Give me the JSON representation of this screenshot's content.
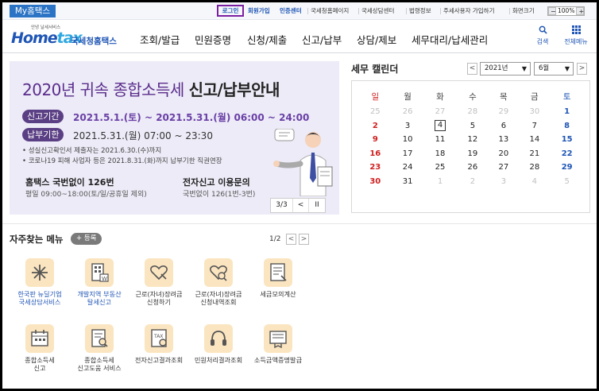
{
  "topbar": {
    "my_tab": "My홈택스",
    "login": "로그인",
    "signup": "회원가입",
    "cert": "인증센터",
    "links": [
      "국세청홈페이지",
      "국세상담센터",
      "법령정보",
      "주세사용자 가입하기",
      "화면크기"
    ],
    "zoom": {
      "minus": "−",
      "value": "100%",
      "plus": "+"
    }
  },
  "header": {
    "logo_sub": "안녕 날세서비스",
    "logo_main_a": "Home",
    "logo_main_b": "tax",
    "logo_kr": "국세청홈택스",
    "nav": [
      "조회/발급",
      "민원증명",
      "신청/제출",
      "신고/납부",
      "상담/제보",
      "세무대리/납세관리"
    ],
    "search_icon": "search-icon",
    "search_label": "검색",
    "menu_icon": "grid-menu-icon",
    "menu_label": "전체메뉴"
  },
  "banner": {
    "title_a": "2020년 귀속 종합소득세 ",
    "title_b": "신고/납부안내",
    "period1_label": "신고기간",
    "period1_value": "2021.5.1.(토) ~ 2021.5.31.(월) 06:00 ~ 24:00",
    "period2_label": "납부기한",
    "period2_value": "2021.5.31.(월) 07:00 ~ 23:30",
    "note1": "• 성실신고확인서 제출자는 2021.6.30.(수)까지",
    "note2": "• 코로나19 피해 사업자 등은 2021.8.31.(화)까지 납부기한 직권연장",
    "contact1_title": "홈택스 국번없이 126번",
    "contact1_sub": "평일 09:00~18:00(토/일/공휴일 제외)",
    "contact2_title": "전자신고 이용문의",
    "contact2_sub": "국번없이 126(1번-3번)",
    "pager": "3/3",
    "prev": "<",
    "pause": "II"
  },
  "calendar": {
    "title": "세무 캘린더",
    "prev": "<",
    "next": ">",
    "year": "2021년",
    "month": "6월",
    "weekdays": [
      "일",
      "월",
      "화",
      "수",
      "목",
      "금",
      "토"
    ],
    "weeks": [
      [
        {
          "d": "25",
          "dim": true
        },
        {
          "d": "26",
          "dim": true
        },
        {
          "d": "27",
          "dim": true
        },
        {
          "d": "28",
          "dim": true
        },
        {
          "d": "29",
          "dim": true
        },
        {
          "d": "30",
          "dim": true
        },
        {
          "d": "1"
        }
      ],
      [
        {
          "d": "2"
        },
        {
          "d": "3"
        },
        {
          "d": "4",
          "today": true
        },
        {
          "d": "5"
        },
        {
          "d": "6"
        },
        {
          "d": "7"
        },
        {
          "d": "8"
        }
      ],
      [
        {
          "d": "9"
        },
        {
          "d": "10"
        },
        {
          "d": "11"
        },
        {
          "d": "12"
        },
        {
          "d": "13"
        },
        {
          "d": "14"
        },
        {
          "d": "15"
        }
      ],
      [
        {
          "d": "16"
        },
        {
          "d": "17"
        },
        {
          "d": "18"
        },
        {
          "d": "19"
        },
        {
          "d": "20"
        },
        {
          "d": "21"
        },
        {
          "d": "22"
        }
      ],
      [
        {
          "d": "23"
        },
        {
          "d": "24"
        },
        {
          "d": "25"
        },
        {
          "d": "26"
        },
        {
          "d": "27"
        },
        {
          "d": "28"
        },
        {
          "d": "29"
        }
      ],
      [
        {
          "d": "30"
        },
        {
          "d": "31"
        },
        {
          "d": "1",
          "dim": true
        },
        {
          "d": "2",
          "dim": true
        },
        {
          "d": "3",
          "dim": true
        },
        {
          "d": "4",
          "dim": true
        },
        {
          "d": "5",
          "dim": true
        }
      ]
    ]
  },
  "favorites": {
    "title": "자주찾는 메뉴",
    "add": "+ 등록",
    "page": "1/2",
    "prev": "<",
    "next": ">",
    "items": [
      {
        "label": "한국판 뉴딜기업\n국세상담서비스",
        "icon": "newdeal-icon",
        "blue": true
      },
      {
        "label": "개발지역 부동산\n탈세신고",
        "icon": "building-report-icon",
        "blue": true
      },
      {
        "label": "근로(자녀)장려금\n신청하기",
        "icon": "heart-hand-icon",
        "blue": false
      },
      {
        "label": "근로(자녀)장려금\n신청내역조회",
        "icon": "heart-search-icon",
        "blue": false
      },
      {
        "label": "세금모의계산",
        "icon": "calculator-doc-icon",
        "blue": false
      },
      {
        "label": "종합소득세\n신고",
        "icon": "calendar-doc-icon",
        "blue": false
      },
      {
        "label": "종합소득세\n신고도움 서비스",
        "icon": "doc-search-icon",
        "blue": false
      },
      {
        "label": "전자신고결과조회",
        "icon": "doc-check-icon",
        "blue": false
      },
      {
        "label": "민원처리결과조회",
        "icon": "headset-icon",
        "blue": false
      },
      {
        "label": "소득금액증명발급",
        "icon": "certificate-icon",
        "blue": false
      }
    ]
  }
}
